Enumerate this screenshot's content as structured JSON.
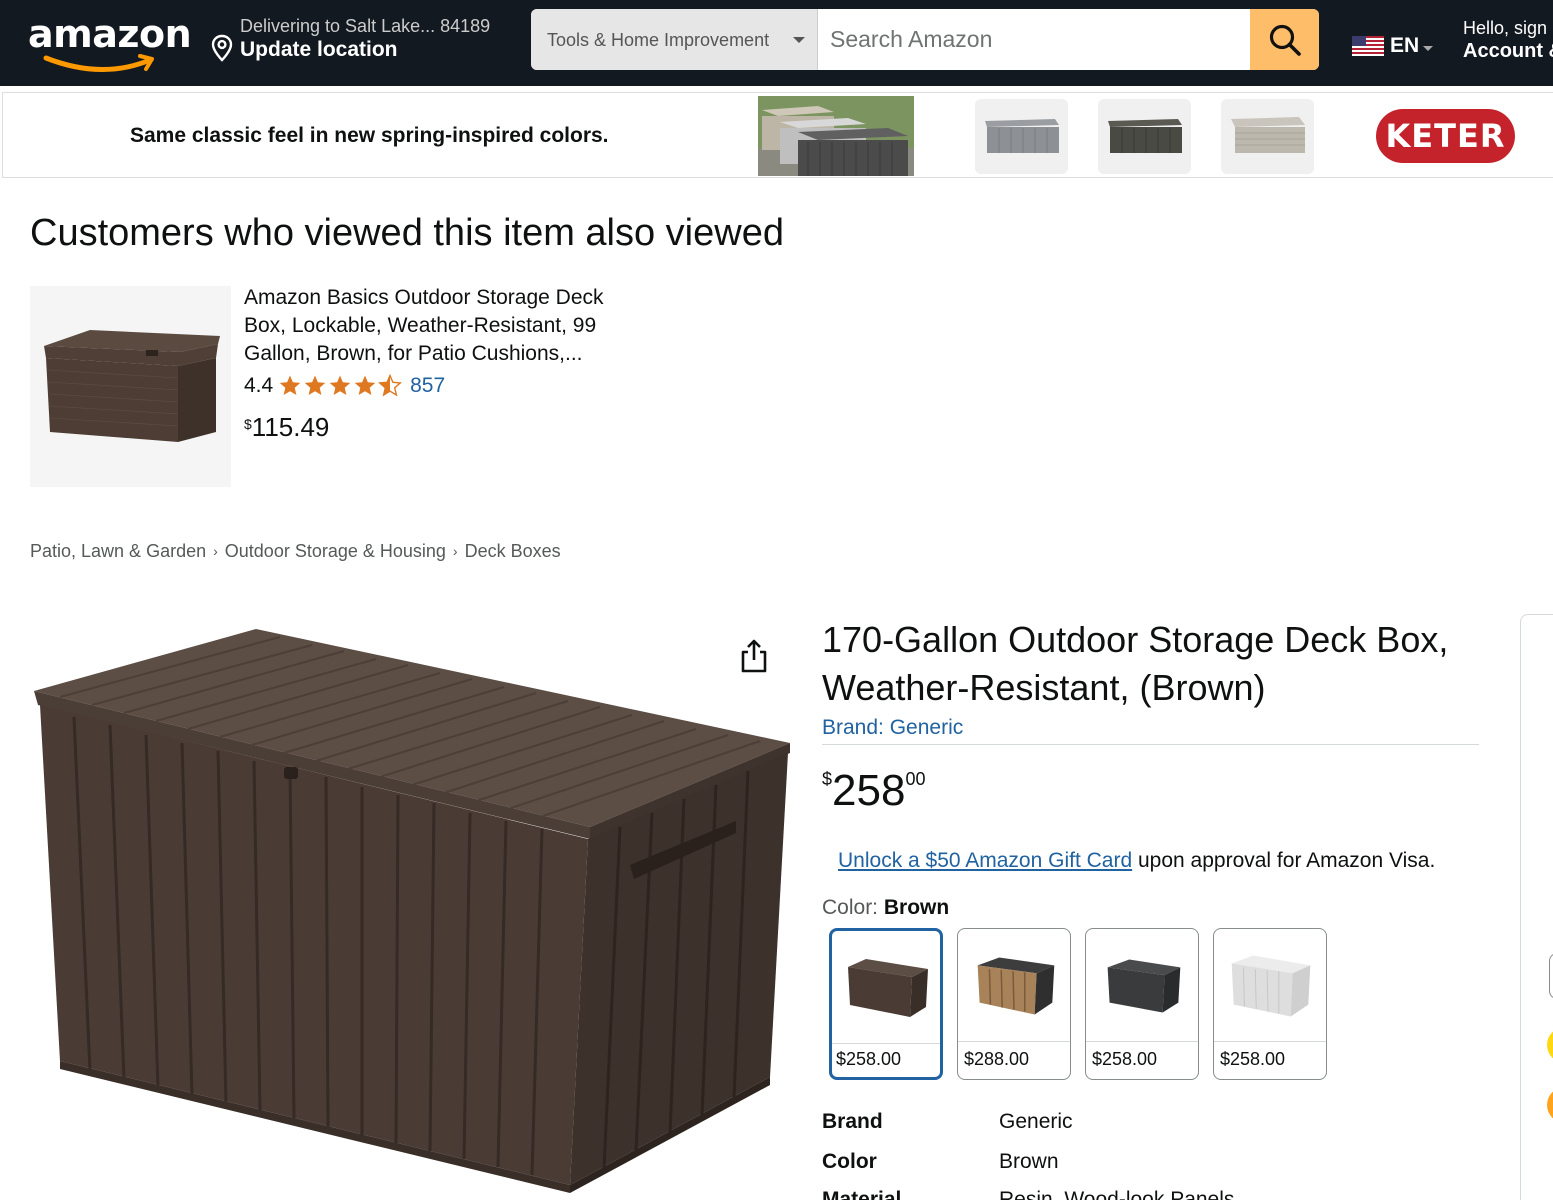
{
  "nav": {
    "logo": "amazon",
    "location_line1": "Delivering to Salt Lake... 84189",
    "location_line2": "Update location",
    "search_category": "Tools & Home Improvement",
    "search_placeholder": "Search Amazon",
    "language": "EN",
    "account_line1": "Hello, sign in",
    "account_line2": "Account & Lists",
    "icons": [
      "location-pin-icon",
      "caret-down-icon",
      "search-icon",
      "us-flag-icon"
    ]
  },
  "banner": {
    "text": "Same classic feel in new spring-inspired colors.",
    "brand_logo": "KETER",
    "brand_color": "#c4232b"
  },
  "also_viewed": {
    "title": "Customers who viewed this item also viewed",
    "items": [
      {
        "title": "Amazon Basics Outdoor Storage Deck Box, Lockable, Weather-Resistant, 99 Gallon, Brown, for Patio Cushions,...",
        "rating": "4.4",
        "stars": 4.5,
        "review_count": "857",
        "price_symbol": "$",
        "price": "115.49"
      }
    ]
  },
  "breadcrumb": [
    "Patio, Lawn & Garden",
    "Outdoor Storage & Housing",
    "Deck Boxes"
  ],
  "product": {
    "title": "170-Gallon Outdoor Storage Deck Box, Weather-Resistant, (Brown)",
    "brand_link": "Brand: Generic",
    "price_symbol": "$",
    "price_whole": "258",
    "price_fraction": "00",
    "promo_link": "Unlock a $50 Amazon Gift Card",
    "promo_text": " upon approval for Amazon Visa.",
    "color_label": "Color: ",
    "color_value": "Brown",
    "swatches": [
      {
        "price": "$258.00",
        "color": "#4a3d36",
        "selected": true
      },
      {
        "price": "$288.00",
        "color": "#a8835a",
        "selected": false
      },
      {
        "price": "$258.00",
        "color": "#3a3b3d",
        "selected": false
      },
      {
        "price": "$258.00",
        "color": "#e4e4e4",
        "selected": false
      }
    ],
    "specs": [
      {
        "key": "Brand",
        "value": "Generic"
      },
      {
        "key": "Color",
        "value": "Brown"
      },
      {
        "key": "Material",
        "value": "Resin, Wood-look Panels"
      }
    ]
  },
  "colors": {
    "nav_bg": "#131921",
    "search_button": "#febd69",
    "link": "#2162a1",
    "star": "#de7921"
  }
}
